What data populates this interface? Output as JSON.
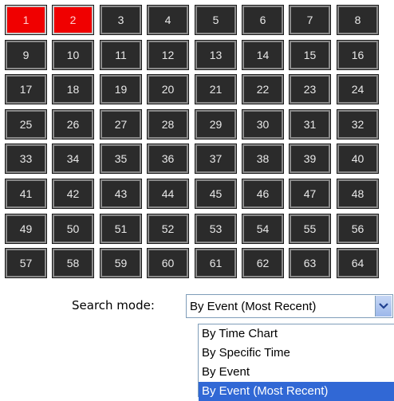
{
  "grid": {
    "cells": [
      "1",
      "2",
      "3",
      "4",
      "5",
      "6",
      "7",
      "8",
      "9",
      "10",
      "11",
      "12",
      "13",
      "14",
      "15",
      "16",
      "17",
      "18",
      "19",
      "20",
      "21",
      "22",
      "23",
      "24",
      "25",
      "26",
      "27",
      "28",
      "29",
      "30",
      "31",
      "32",
      "33",
      "34",
      "35",
      "36",
      "37",
      "38",
      "39",
      "40",
      "41",
      "42",
      "43",
      "44",
      "45",
      "46",
      "47",
      "48",
      "49",
      "50",
      "51",
      "52",
      "53",
      "54",
      "55",
      "56",
      "57",
      "58",
      "59",
      "60",
      "61",
      "62",
      "63",
      "64"
    ],
    "selected": [
      "1",
      "2"
    ],
    "selected_color": "#f00000",
    "cell_color": "#2b2b2b"
  },
  "search": {
    "label": "Search mode:",
    "value": "By Event (Most Recent)",
    "arrow_icon": "chevron-down-icon",
    "options": [
      "By Time Chart",
      "By Specific Time",
      "By Event",
      "By Event (Most Recent)"
    ],
    "highlighted": "By Event (Most Recent)",
    "highlight_color": "#3168d5"
  }
}
